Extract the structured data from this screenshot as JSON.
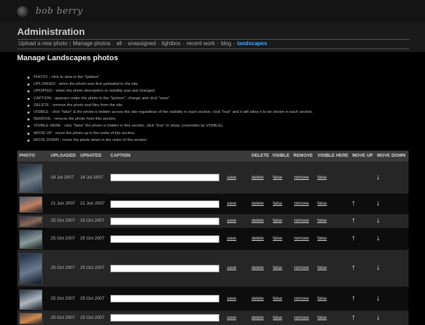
{
  "header": {
    "logo_text": "bob berry",
    "title": "Administration"
  },
  "nav": {
    "items": [
      {
        "label": "Upload a new photo",
        "sep": "|"
      },
      {
        "label": "Manage photos",
        "sep": ":"
      },
      {
        "label": "all",
        "sep": "-"
      },
      {
        "label": "unassigned",
        "sep": "-"
      },
      {
        "label": "lightbox",
        "sep": "-"
      },
      {
        "label": "recent work",
        "sep": "-"
      },
      {
        "label": "blog",
        "sep": "-"
      },
      {
        "label": "landscapes",
        "sep": ""
      }
    ],
    "active": "landscapes"
  },
  "section_title": "Manage Landscapes photos",
  "help": [
    "PHOTO - click to view in the \"lytebox\".",
    "UPLOADED - when the photo was first uploaded to the site.",
    "UPDATED - when the photo description or visibility was last changed.",
    "CAPTION - appears under the photo in the \"lytebox\", change and click \"save\".",
    "DELETE - remove the photo and files from the site.",
    "VISIBLE - click \"false\" & the photo is hidden across the site regardless of the visibility in each section. click \"true\" and it will allow it to be shown in each section.",
    "REMOVE - remove the photo from this section.",
    "VISIBLE HERE - click \"false\" the photo is hidden in this section, click \"true\" to show, (overriden by VISIBLE).",
    "MOVE UP - move the photo up in the order of the section.",
    "MOVE DOWN - move the photo down in the order of the section."
  ],
  "table": {
    "headers": [
      "PHOTO",
      "UPLOADED",
      "UPDATED",
      "CAPTION",
      "DELETE",
      "VISIBLE",
      "REMOVE",
      "VISIBLE HERE",
      "MOVE UP",
      "MOVE DOWN"
    ],
    "save_label": "save",
    "rows": [
      {
        "uploaded": "18 Jul 2007",
        "updated": "18 Jul 2007",
        "caption": "",
        "delete": "delete",
        "visible": "false",
        "remove": "remove",
        "visible_here": "false",
        "up": "",
        "down": "↓",
        "thumb_colors": [
          "#1c2836",
          "#6f7c88",
          "#2a3440"
        ]
      },
      {
        "uploaded": "21 Jun 2007",
        "updated": "21 Jun 2007",
        "caption": "",
        "delete": "delete",
        "visible": "false",
        "remove": "remove",
        "visible_here": "false",
        "up": "↑",
        "down": "↓",
        "thumb_colors": [
          "#4a5a7a",
          "#c08060",
          "#1a1a22"
        ]
      },
      {
        "uploaded": "25 Oct 2007",
        "updated": "25 Oct 2007",
        "caption": "",
        "delete": "delete",
        "visible": "false",
        "remove": "remove",
        "visible_here": "false",
        "up": "↑",
        "down": "↓",
        "thumb_colors": [
          "#3a3040",
          "#8a6a5a",
          "#15151a"
        ]
      },
      {
        "uploaded": "25 Oct 2007",
        "updated": "25 Oct 2007",
        "caption": "",
        "delete": "delete",
        "visible": "false",
        "remove": "remove",
        "visible_here": "false",
        "up": "↑",
        "down": "↓",
        "thumb_colors": [
          "#2a3a4a",
          "#8a9a9a",
          "#1a2020"
        ]
      },
      {
        "uploaded": "25 Oct 2007",
        "updated": "25 Oct 2007",
        "caption": "",
        "delete": "delete",
        "visible": "false",
        "remove": "remove",
        "visible_here": "false",
        "up": "↑",
        "down": "↓",
        "thumb_colors": [
          "#1e2a40",
          "#6a7a90",
          "#0e1420"
        ]
      },
      {
        "uploaded": "25 Oct 2007",
        "updated": "25 Oct 2007",
        "caption": "",
        "delete": "delete",
        "visible": "false",
        "remove": "remove",
        "visible_here": "false",
        "up": "↑",
        "down": "↓",
        "thumb_colors": [
          "#243040",
          "#b0b8c0",
          "#1a2028"
        ]
      },
      {
        "uploaded": "25 Oct 2007",
        "updated": "25 Oct 2007",
        "caption": "",
        "delete": "delete",
        "visible": "false",
        "remove": "remove",
        "visible_here": "false",
        "up": "↑",
        "down": "↓",
        "thumb_colors": [
          "#5a4a40",
          "#d08a50",
          "#2a2020"
        ]
      }
    ]
  }
}
